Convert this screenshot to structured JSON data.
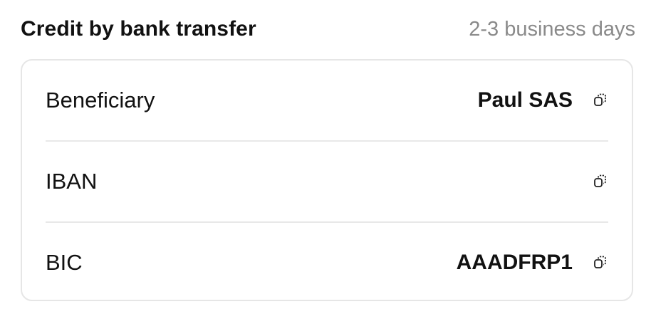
{
  "header": {
    "title": "Credit by bank transfer",
    "subtitle": "2-3 business days"
  },
  "rows": [
    {
      "label": "Beneficiary",
      "value": "Paul SAS",
      "icon": "copy-icon"
    },
    {
      "label": "IBAN",
      "value": "",
      "icon": "copy-icon"
    },
    {
      "label": "BIC",
      "value": "AAADFRP1",
      "icon": "copy-icon"
    }
  ]
}
